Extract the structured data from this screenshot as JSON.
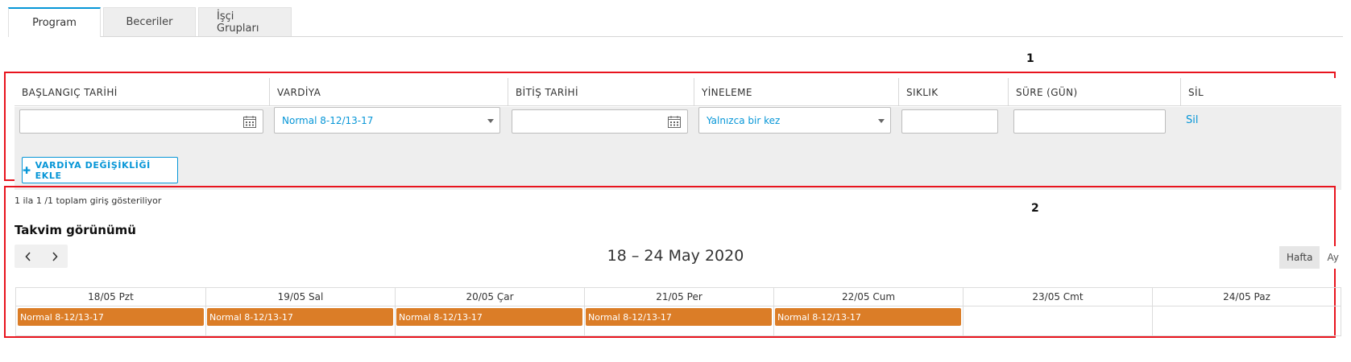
{
  "tabs": [
    {
      "label": "Program",
      "active": true
    },
    {
      "label": "Beceriler",
      "active": false
    },
    {
      "label": "İşçi Grupları",
      "active": false
    }
  ],
  "annotations": {
    "box1_label": "1",
    "box2_label": "2"
  },
  "schedule": {
    "columns": [
      "BAŞLANGIÇ TARİHİ",
      "VARDİYA",
      "BİTİŞ TARİHİ",
      "YİNELEME",
      "SIKLIK",
      "SÜRE (GÜN)",
      "SİL"
    ],
    "row": {
      "start_date": "",
      "shift": "Normal 8-12/13-17",
      "end_date": "",
      "repeat": "Yalnızca bir kez",
      "frequency": "",
      "duration": "",
      "delete_link": "Sil"
    },
    "add_button": "VARDİYA DEĞİŞİKLİĞİ EKLE"
  },
  "entries_text": "1 ila 1 /1 toplam giriş gösteriliyor",
  "calendar": {
    "title": "Takvim görünümü",
    "range": "18 – 24 May 2020",
    "views": [
      {
        "label": "Hafta",
        "active": true
      },
      {
        "label": "Ay",
        "active": false
      }
    ],
    "days": [
      "18/05 Pzt",
      "19/05 Sal",
      "20/05 Çar",
      "21/05 Per",
      "22/05 Cum",
      "23/05 Cmt",
      "24/05 Paz"
    ],
    "events": [
      "Normal 8-12/13-17",
      "Normal 8-12/13-17",
      "Normal 8-12/13-17",
      "Normal 8-12/13-17",
      "Normal 8-12/13-17",
      "",
      ""
    ],
    "event_color": "#db7d27"
  },
  "colors": {
    "accent": "#0696d7",
    "annotation": "#e8141e"
  }
}
